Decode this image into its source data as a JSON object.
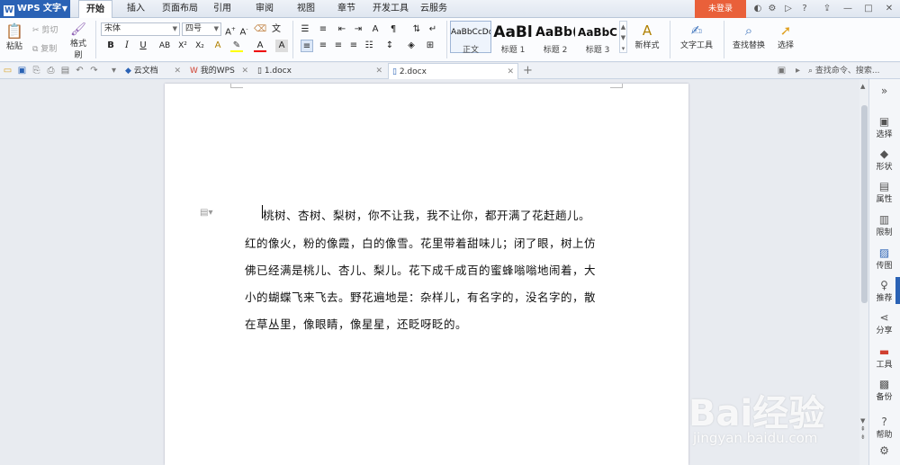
{
  "app": {
    "title": "WPS 文字",
    "logo": "W"
  },
  "menu_tabs": [
    "开始",
    "插入",
    "页面布局",
    "引用",
    "审阅",
    "视图",
    "章节",
    "开发工具",
    "云服务"
  ],
  "login_label": "未登录",
  "ribbon": {
    "paste": "粘贴",
    "cut": "剪切",
    "copy": "复制",
    "format_painter": "格式刷",
    "font_name": "宋体",
    "font_size": "四号",
    "styles": [
      {
        "sample": "AaBbCcDd",
        "name": "正文"
      },
      {
        "sample": "AaBl",
        "name": "标题 1"
      },
      {
        "sample": "AaBb(",
        "name": "标题 2"
      },
      {
        "sample": "AaBbC",
        "name": "标题 3"
      }
    ],
    "new_style": "新样式",
    "text_tools": "文字工具",
    "find_replace": "查找替换",
    "select": "选择"
  },
  "doc_tabs": [
    "云文档",
    "我的WPS",
    "1.docx",
    "2.docx"
  ],
  "search_placeholder": "查找命令、搜索...",
  "document": {
    "paragraph_lines": [
      "桃树、杏树、梨树，你不让我，我不让你，都开满了花赶趟儿。",
      "红的像火，粉的像霞，白的像雪。花里带着甜味儿；闭了眼，树上仿",
      "佛已经满是桃儿、杏儿、梨儿。花下成千成百的蜜蜂嗡嗡地闹着，大",
      "小的蝴蝶飞来飞去。野花遍地是：杂样儿，有名字的，没名字的，散",
      "在草丛里，像眼睛，像星星，还眨呀眨的。"
    ]
  },
  "sidebar": [
    "选择",
    "形状",
    "属性",
    "限制",
    "传图",
    "推荐",
    "分享",
    "工具",
    "备份",
    "帮助"
  ],
  "watermark": {
    "brand": "Bai经验",
    "url": "jingyan.baidu.com"
  },
  "colors": {
    "accent": "#2a62b5",
    "login": "#e9603a"
  }
}
